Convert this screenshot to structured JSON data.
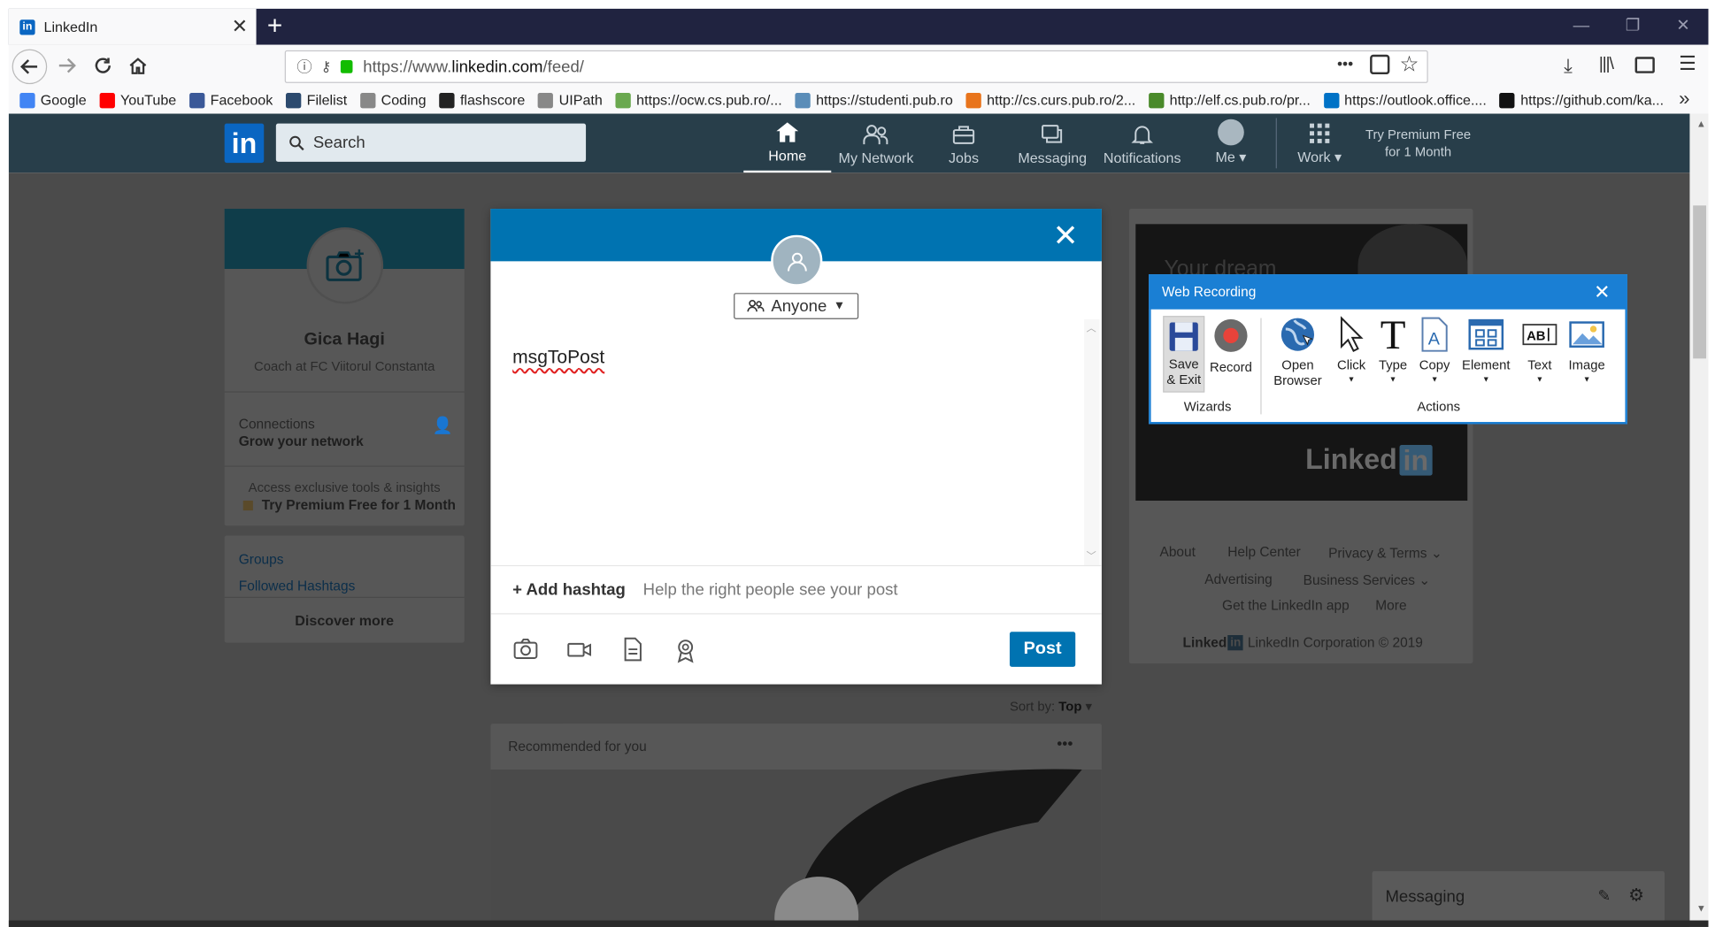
{
  "browser": {
    "tab_title": "LinkedIn",
    "tab_close": "✕",
    "new_tab": "+",
    "url_prefix": "https://www.",
    "url_domain": "linkedin.com",
    "url_path": "/feed/",
    "page_actions": "•••",
    "bookmarks": [
      {
        "label": "Google",
        "color": "#4285f4"
      },
      {
        "label": "YouTube",
        "color": "#ff0000"
      },
      {
        "label": "Facebook",
        "color": "#3b5998"
      },
      {
        "label": "Filelist",
        "color": "#2c4a6e"
      },
      {
        "label": "Coding",
        "color": "#888888"
      },
      {
        "label": "flashscore",
        "color": "#222222"
      },
      {
        "label": "UIPath",
        "color": "#888888"
      },
      {
        "label": "https://ocw.cs.pub.ro/...",
        "color": "#6aa84f"
      },
      {
        "label": "https://studenti.pub.ro",
        "color": "#5b8db8"
      },
      {
        "label": "http://cs.curs.pub.ro/2...",
        "color": "#e8741c"
      },
      {
        "label": "http://elf.cs.pub.ro/pr...",
        "color": "#4a8a2a"
      },
      {
        "label": "https://outlook.office....",
        "color": "#0072c6"
      },
      {
        "label": "https://github.com/ka...",
        "color": "#111111"
      }
    ],
    "bookmarks_overflow": "»"
  },
  "linkedin": {
    "logo": "in",
    "search_placeholder": "Search",
    "nav": [
      {
        "key": "home",
        "label": "Home"
      },
      {
        "key": "network",
        "label": "My Network"
      },
      {
        "key": "jobs",
        "label": "Jobs"
      },
      {
        "key": "messaging",
        "label": "Messaging"
      },
      {
        "key": "notifications",
        "label": "Notifications"
      },
      {
        "key": "me",
        "label": "Me ▾"
      },
      {
        "key": "work",
        "label": "Work ▾"
      }
    ],
    "premium_line1": "Try Premium Free",
    "premium_line2": "for 1 Month"
  },
  "profile": {
    "name": "Gica Hagi",
    "headline": "Coach at FC Viitorul Constanta",
    "connections_label": "Connections",
    "connections_sub": "Grow your network",
    "premium_hint": "Access exclusive tools & insights",
    "premium_cta": "Try Premium Free for 1 Month",
    "groups": "Groups",
    "hashtags": "Followed Hashtags",
    "discover": "Discover more"
  },
  "composer": {
    "close": "✕",
    "visibility": "Anyone",
    "text": "msgToPost",
    "add_hashtag": "+ Add hashtag",
    "hashtag_help": "Help the right people see your post",
    "post_button": "Post"
  },
  "feed": {
    "sort_label": "Sort by:",
    "sort_value": "Top",
    "recommended": "Recommended for you",
    "more": "•••"
  },
  "footer": {
    "links": [
      "About",
      "Help Center",
      "Privacy & Terms ⌄",
      "Advertising",
      "Business Services ⌄",
      "Get the LinkedIn app",
      "More"
    ],
    "brand": "Linked",
    "copyright": "LinkedIn Corporation © 2019"
  },
  "ad": {
    "headline": "Your dream",
    "brand": "Linked"
  },
  "web_recording": {
    "title": "Web Recording",
    "close": "✕",
    "buttons": {
      "save_exit": "Save & Exit",
      "record": "Record",
      "open_browser": "Open Browser",
      "click": "Click",
      "type": "Type",
      "copy": "Copy",
      "element": "Element",
      "text": "Text",
      "image": "Image"
    },
    "group_wizards": "Wizards",
    "group_actions": "Actions",
    "accent": "#1a7fd4"
  },
  "messaging": {
    "label": "Messaging"
  }
}
